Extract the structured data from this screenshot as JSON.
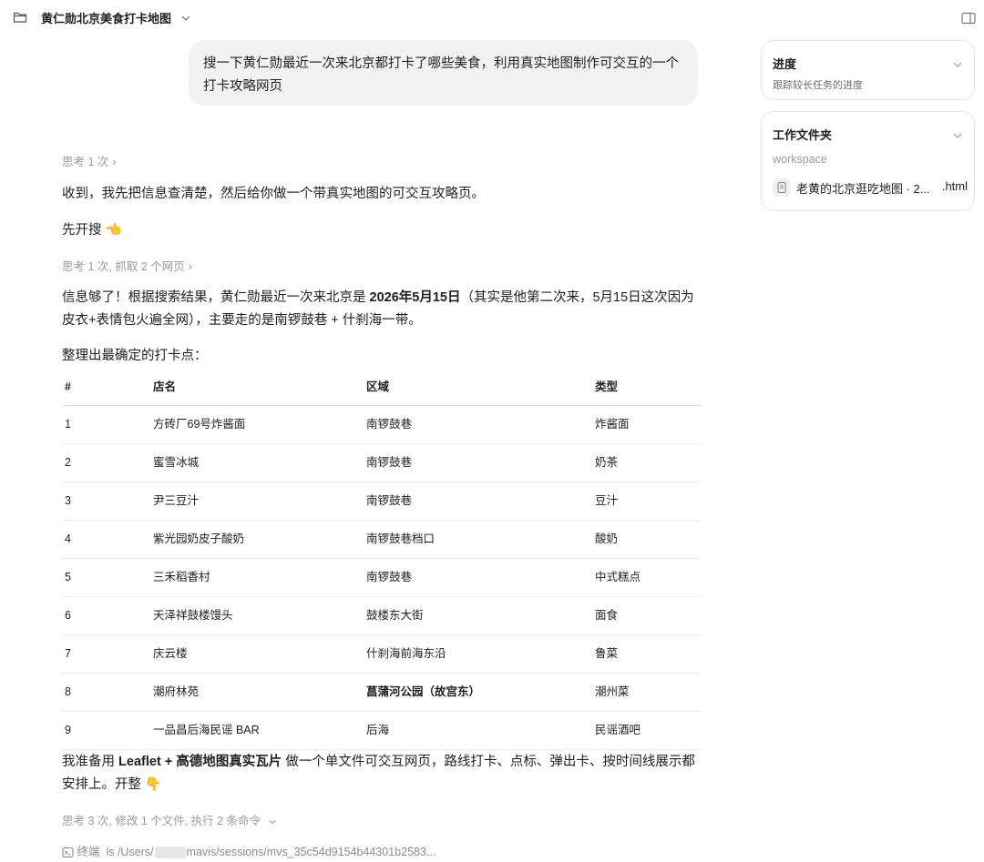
{
  "header": {
    "title": "黄仁勋北京美食打卡地图"
  },
  "user_message": {
    "text": "搜一下黄仁勋最近一次来北京都打卡了哪些美食，利用真实地图制作可交互的一个打卡攻略网页"
  },
  "assistant": {
    "meta1": "思考 1 次",
    "para1": "收到，我先把信息查清楚，然后给你做一个带真实地图的可交互攻略页。",
    "para2": "先开搜 👈",
    "meta2": "思考 1 次, 抓取 2 个网页",
    "para3_part1": "信息够了！根据搜索结果，黄仁勋最近一次来北京是 ",
    "para3_bold": "2026年5月15日",
    "para3_part2": "（其实是他第二次来，5月15日这次因为皮衣+表情包火遍全网），主要走的是南锣鼓巷 + 什刹海一带。",
    "para4": "整理出最确定的打卡点：",
    "para5_part1": "我准备用 ",
    "para5_bold": "Leaflet + 高德地图真实瓦片",
    "para5_part2": " 做一个单文件可交互网页，路线打卡、点标、弹出卡、按时间线展示都安排上。开整 👇",
    "meta3": "思考 3 次, 修改 1 个文件, 执行 2 条命令",
    "terminal_label": "终端",
    "terminal_cmd_prefix": "ls /Users/",
    "terminal_cmd_suffix": "mavis/sessions/mvs_35c54d9154b44301b2583..."
  },
  "table": {
    "headers": [
      "#",
      "店名",
      "区域",
      "类型"
    ],
    "rows": [
      [
        "1",
        "方砖厂69号炸酱面",
        "南锣鼓巷",
        "炸酱面"
      ],
      [
        "2",
        "蜜雪冰城",
        "南锣鼓巷",
        "奶茶"
      ],
      [
        "3",
        "尹三豆汁",
        "南锣鼓巷",
        "豆汁"
      ],
      [
        "4",
        "紫光园奶皮子酸奶",
        "南锣鼓巷档口",
        "酸奶"
      ],
      [
        "5",
        "三禾稻香村",
        "南锣鼓巷",
        "中式糕点"
      ],
      [
        "6",
        "天泽祥鼓楼馒头",
        "鼓楼东大街",
        "面食"
      ],
      [
        "7",
        "庆云楼",
        "什刹海前海东沿",
        "鲁菜"
      ],
      [
        "8",
        "潮府林苑",
        "菖蒲河公园（故宫东）",
        "潮州菜"
      ],
      [
        "9",
        "一品昌后海民谣 BAR",
        "后海",
        "民谣酒吧"
      ]
    ]
  },
  "sidebar": {
    "progress_title": "进度",
    "progress_sub": "跟踪较长任务的进度",
    "workspace_title": "工作文件夹",
    "workspace_label": "workspace",
    "file_name": "老黄的北京逛吃地图 · 2...",
    "file_ext": ".html"
  }
}
